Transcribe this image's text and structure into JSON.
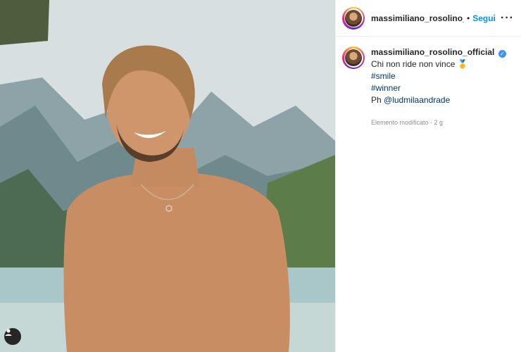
{
  "post": {
    "username": "massimiliano_rosolino_offi",
    "dot": "•",
    "follow": "Segui",
    "more": "···"
  },
  "caption": {
    "username": "massimiliano_rosolino_official",
    "verified_glyph": "✓",
    "text": "Chi non ride non vince",
    "emoji": "🥇",
    "hashtags": [
      "#smile",
      "#winner"
    ],
    "credit_prefix": "Ph",
    "credit_mention": "@ludmilaandrade",
    "meta": "Elemento modificato · 2 g"
  },
  "icons": {
    "user_tag": "person-icon",
    "verified": "verified-badge-icon",
    "more": "more-options-icon"
  },
  "colors": {
    "accent": "#0095f6",
    "link": "#00376b",
    "verified": "#3897f0"
  }
}
